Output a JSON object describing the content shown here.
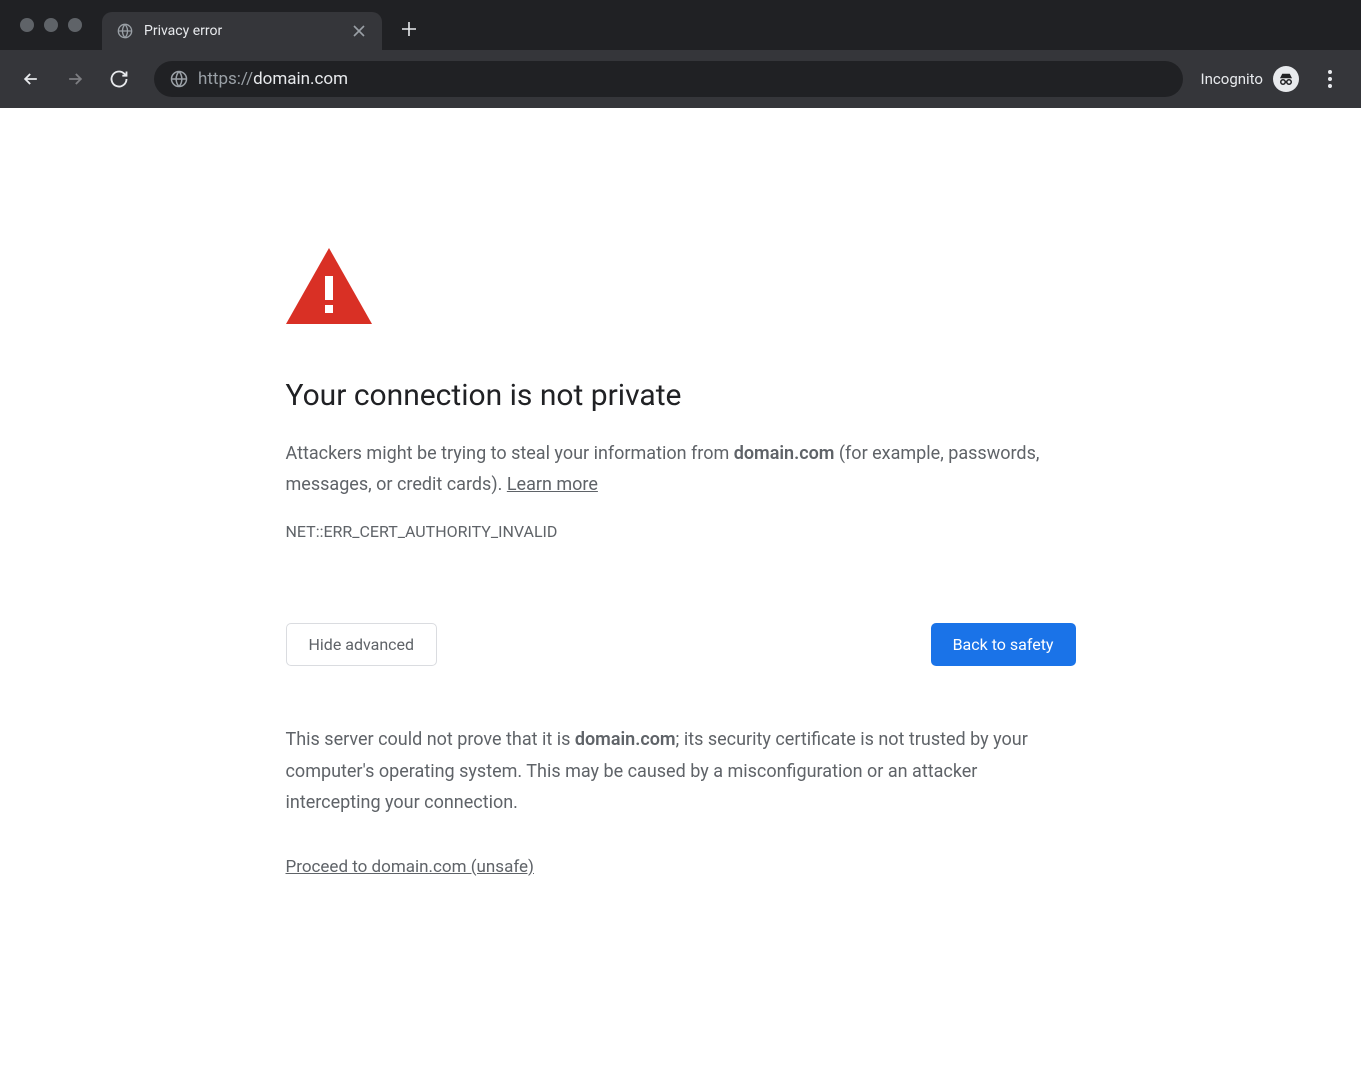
{
  "chrome": {
    "tab": {
      "title": "Privacy error"
    },
    "url": {
      "scheme": "https://",
      "host": "domain.com"
    },
    "incognito_label": "Incognito"
  },
  "page": {
    "heading": "Your connection is not private",
    "body_prefix": "Attackers might be trying to steal your information from ",
    "body_domain": "domain.com",
    "body_suffix": " (for example, passwords, messages, or credit cards). ",
    "learn_more": "Learn more",
    "error_code": "NET::ERR_CERT_AUTHORITY_INVALID",
    "hide_advanced_label": "Hide advanced",
    "back_label": "Back to safety",
    "advanced_prefix": "This server could not prove that it is ",
    "advanced_domain": "domain.com",
    "advanced_suffix": "; its security certificate is not trusted by your computer's operating system. This may be caused by a misconfiguration or an attacker intercepting your connection.",
    "proceed_label": "Proceed to domain.com (unsafe)"
  }
}
